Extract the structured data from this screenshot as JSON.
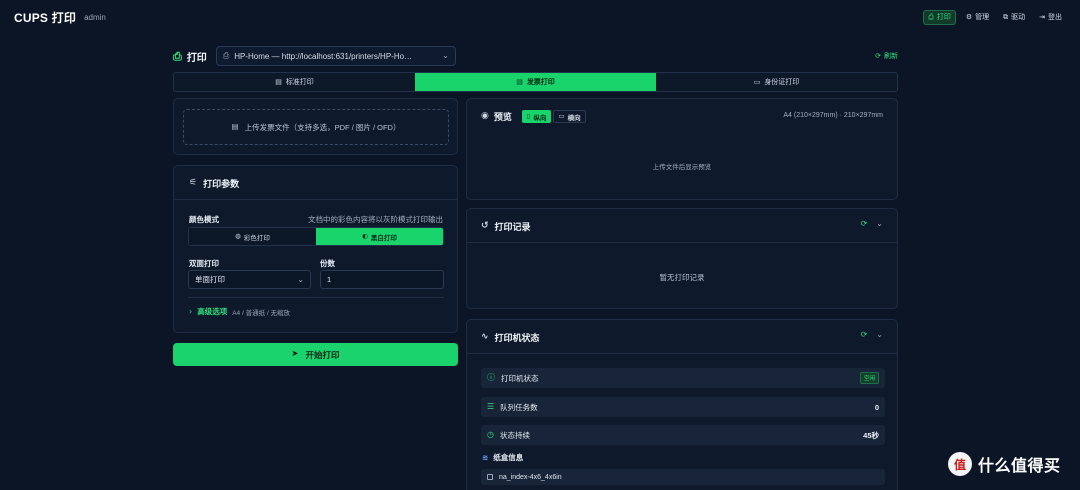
{
  "app": {
    "title": "CUPS 打印",
    "user": "admin"
  },
  "topnav": [
    {
      "label": "打印",
      "icon": "printer-icon"
    },
    {
      "label": "管理",
      "icon": "gear-icon"
    },
    {
      "label": "驱动",
      "icon": "link-icon"
    },
    {
      "label": "登出",
      "icon": "logout-icon"
    }
  ],
  "header": {
    "title": "打印",
    "printer_value": "HP-Home — http://localhost:631/printers/HP-Ho…",
    "refresh_label": "刷新"
  },
  "tabs": [
    {
      "label": "标准打印"
    },
    {
      "label": "发票打印"
    },
    {
      "label": "身份证打印"
    }
  ],
  "upload": {
    "label": "上传发票文件（支持多选，PDF / 图片 / OFD）"
  },
  "params": {
    "title": "打印参数",
    "color_mode_label": "颜色模式",
    "color_hint": "文档中的彩色内容将以灰阶模式打印输出",
    "color_options": [
      "彩色打印",
      "黑白打印"
    ],
    "duplex_label": "双面打印",
    "duplex_value": "单面打印",
    "copies_label": "份数",
    "copies_value": "1",
    "advanced_label": "高级选项",
    "advanced_summary": "A4 / 普通纸 / 无缩放"
  },
  "start_button": "开始打印",
  "preview": {
    "title": "预览",
    "orientation": [
      "纵向",
      "横向"
    ],
    "paper_info": "A4 (210×297mm) · 210×297mm",
    "hint": "上传文件后显示预览"
  },
  "history": {
    "title": "打印记录",
    "empty": "暂无打印记录"
  },
  "printer_status": {
    "title": "打印机状态",
    "rows": [
      {
        "label": "打印机状态",
        "badge": "空闲"
      },
      {
        "label": "队列任务数",
        "value": "0"
      },
      {
        "label": "状态持续",
        "value": "45秒"
      }
    ],
    "tray_title": "纸盒信息",
    "trays": [
      "na_index-4x6_4x6in"
    ]
  },
  "watermark": {
    "text": "什么值得买",
    "logo": "值"
  }
}
